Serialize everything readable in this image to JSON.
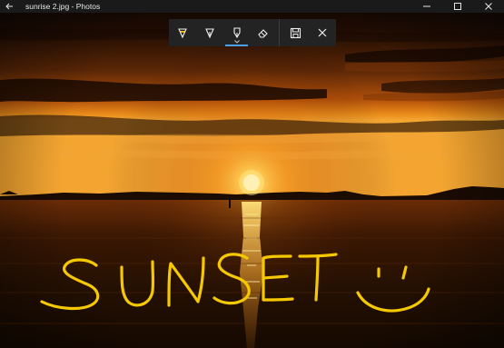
{
  "window": {
    "title": "sunrise 2.jpg - Photos"
  },
  "toolbar": {
    "tools": [
      {
        "name": "ballpoint-pen",
        "selected": false
      },
      {
        "name": "pencil",
        "selected": false
      },
      {
        "name": "calligraphy-pen",
        "selected": true
      },
      {
        "name": "eraser",
        "selected": false
      }
    ],
    "actions": [
      {
        "name": "save"
      },
      {
        "name": "close"
      }
    ]
  },
  "drawing": {
    "ink_color": "#f5c800"
  },
  "colors": {
    "titlebar_bg": "#1a1a1a",
    "toolbar_bg": "#232323",
    "accent": "#4ca0e6"
  }
}
